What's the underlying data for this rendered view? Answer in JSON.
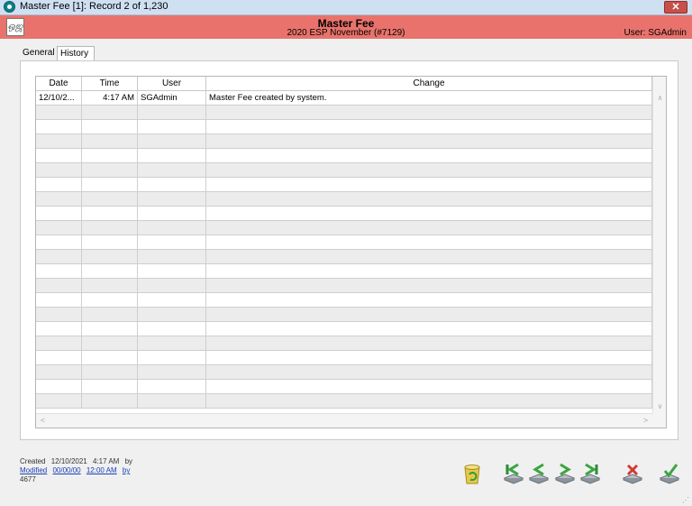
{
  "window": {
    "title": "Master Fee [1]: Record 2 of 1,230"
  },
  "header": {
    "title": "Master Fee",
    "subtitle": "2020 ESP November (#7129)",
    "user": "User: SGAdmin"
  },
  "tabs": [
    {
      "label": "General",
      "active": false
    },
    {
      "label": "History",
      "active": true
    }
  ],
  "history": {
    "columns": [
      "Date",
      "Time",
      "User",
      "Change"
    ],
    "rows": [
      {
        "date": "12/10/2...",
        "time": "4:17 AM",
        "user": "SGAdmin",
        "change": "Master Fee created by system."
      }
    ],
    "empty_row_count": 21
  },
  "footer": {
    "created_label": "Created",
    "created_date": "12/10/2021",
    "created_time": "4:17 AM",
    "created_by": "by",
    "modified_label": "Modified",
    "modified_date": "00/00/00",
    "modified_time": "12:00 AM",
    "modified_by": "by",
    "id": "4677"
  },
  "toolbar": {
    "buttons": [
      "recycle-icon",
      "first-record-icon",
      "previous-record-icon",
      "next-record-icon",
      "last-record-icon",
      "cancel-icon",
      "save-icon"
    ]
  },
  "colors": {
    "header": "#e9736c",
    "alt_row": "#ececec",
    "titlebar": "#cfe0f3"
  }
}
